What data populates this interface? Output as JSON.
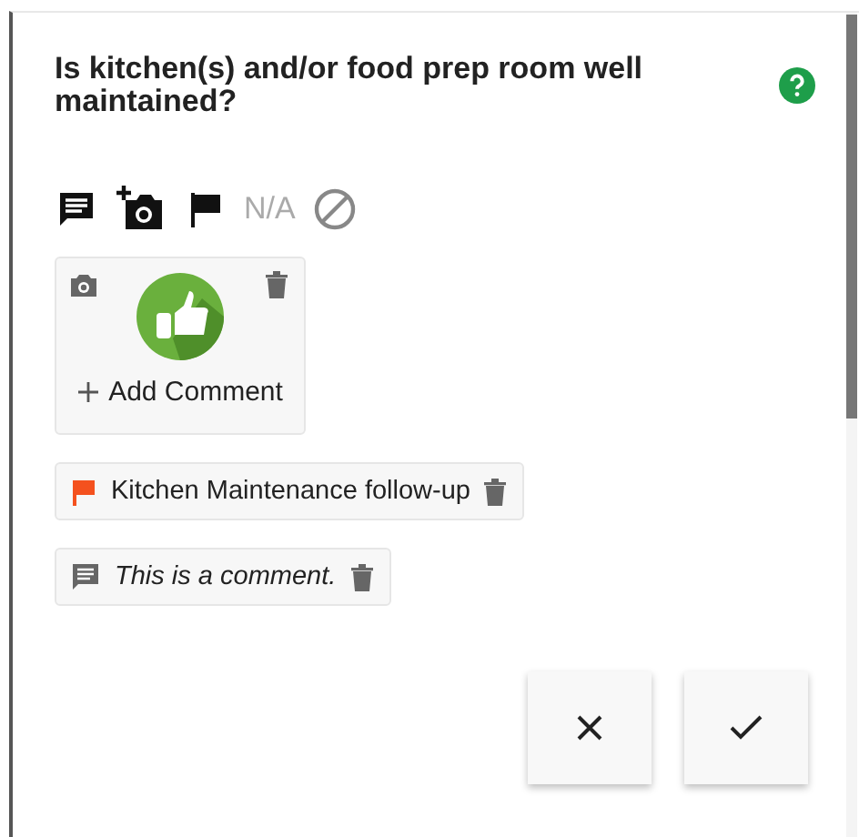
{
  "question": {
    "text": "Is kitchen(s) and/or food prep room well maintained?"
  },
  "toolbar": {
    "na_label": "N/A"
  },
  "photo_card": {
    "add_comment": "Add Comment"
  },
  "attachments": [
    {
      "kind": "flag",
      "text": "Kitchen Maintenance follow-up"
    },
    {
      "kind": "comment",
      "text": "This is a comment."
    }
  ]
}
